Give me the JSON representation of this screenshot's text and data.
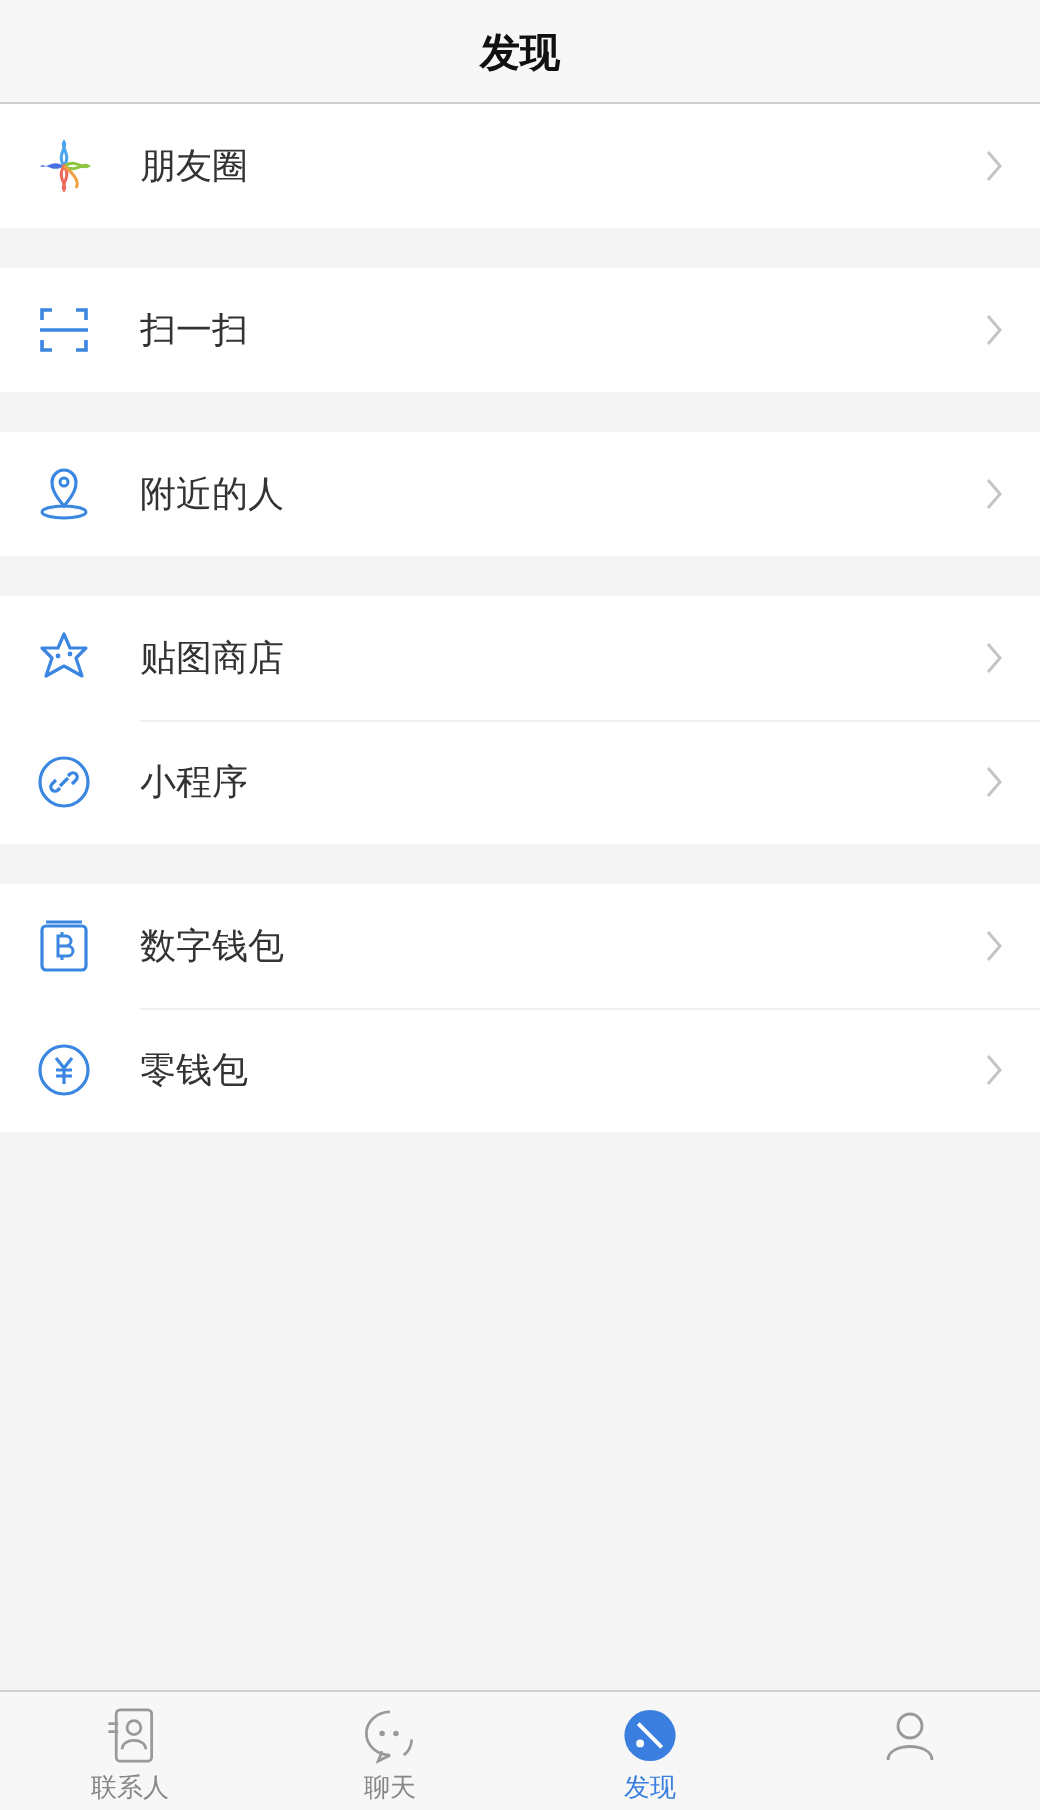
{
  "header": {
    "title": "发现"
  },
  "groups": [
    {
      "items": [
        {
          "label": "朋友圈"
        }
      ]
    },
    {
      "items": [
        {
          "label": "扫一扫"
        }
      ]
    },
    {
      "items": [
        {
          "label": "附近的人"
        }
      ]
    },
    {
      "items": [
        {
          "label": "贴图商店"
        },
        {
          "label": "小程序"
        }
      ]
    },
    {
      "items": [
        {
          "label": "数字钱包"
        },
        {
          "label": "零钱包"
        }
      ]
    }
  ],
  "tabs": [
    {
      "label": "联系人",
      "selected": false
    },
    {
      "label": "聊天",
      "selected": false
    },
    {
      "label": "发现",
      "selected": true
    },
    {
      "selected": false
    }
  ]
}
